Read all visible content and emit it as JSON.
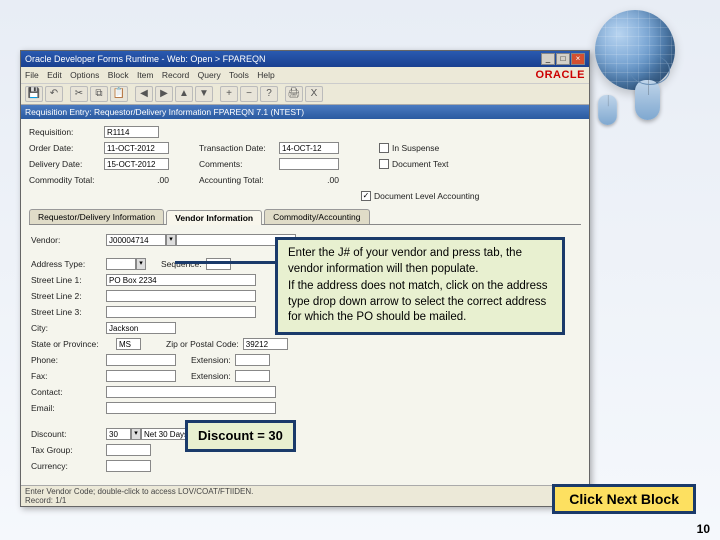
{
  "window": {
    "title": "Oracle Developer Forms Runtime - Web: Open > FPAREQN"
  },
  "menubar": {
    "items": [
      "File",
      "Edit",
      "Options",
      "Block",
      "Item",
      "Record",
      "Query",
      "Tools",
      "Help"
    ],
    "brand": "ORACLE"
  },
  "subheader": "Requisition Entry: Requestor/Delivery Information FPAREQN 7.1 (NTEST)",
  "top_form": {
    "requisition_label": "Requisition:",
    "requisition_value": "R1114",
    "order_date_label": "Order Date:",
    "order_date_value": "11-OCT-2012",
    "transaction_date_label": "Transaction Date:",
    "transaction_date_value": "14-OCT-12",
    "in_suspense_label": "In Suspense",
    "delivery_date_label": "Delivery Date:",
    "delivery_date_value": "15-OCT-2012",
    "comments_label": "Comments:",
    "document_text_label": "Document Text",
    "commodity_total_label": "Commodity Total:",
    "commodity_total_value": ".00",
    "accounting_total_label": "Accounting Total:",
    "accounting_total_value": ".00",
    "doc_level_acct_label": "Document Level Accounting",
    "doc_level_acct_checked": true
  },
  "tabs": {
    "t1": "Requestor/Delivery Information",
    "t2": "Vendor Information",
    "t3": "Commodity/Accounting"
  },
  "vendor": {
    "vendor_label": "Vendor:",
    "vendor_id": "J00004714",
    "vendor_name": "",
    "address_type_label": "Address Type:",
    "sequence_label": "Sequence:",
    "street1_label": "Street Line 1:",
    "street1_value": "PO Box 2234",
    "street2_label": "Street Line 2:",
    "street3_label": "Street Line 3:",
    "city_label": "City:",
    "city_value": "Jackson",
    "state_label": "State or Province:",
    "state_value": "MS",
    "zip_label": "Zip or Postal Code:",
    "zip_value": "39212",
    "phone_label": "Phone:",
    "ext1_label": "Extension:",
    "fax_label": "Fax:",
    "ext2_label": "Extension:",
    "contact_label": "Contact:",
    "email_label": "Email:",
    "discount_label": "Discount:",
    "discount_code": "30",
    "discount_desc": "Net 30 Days",
    "tax_group_label": "Tax Group:",
    "currency_label": "Currency:"
  },
  "statusbar": {
    "line1": "Enter Vendor Code; double-click to access LOV/COAT/FTIIDEN.",
    "line2": "Record: 1/1"
  },
  "callouts": {
    "c1_line1": "Enter the J# of your vendor and press tab, the vendor information will then populate.",
    "c1_line2": "If the address does not match, click on the address type drop down arrow to select the correct address for which the PO should be mailed.",
    "c2": "Discount = 30",
    "c3": "Click Next Block"
  },
  "page_number": "10"
}
